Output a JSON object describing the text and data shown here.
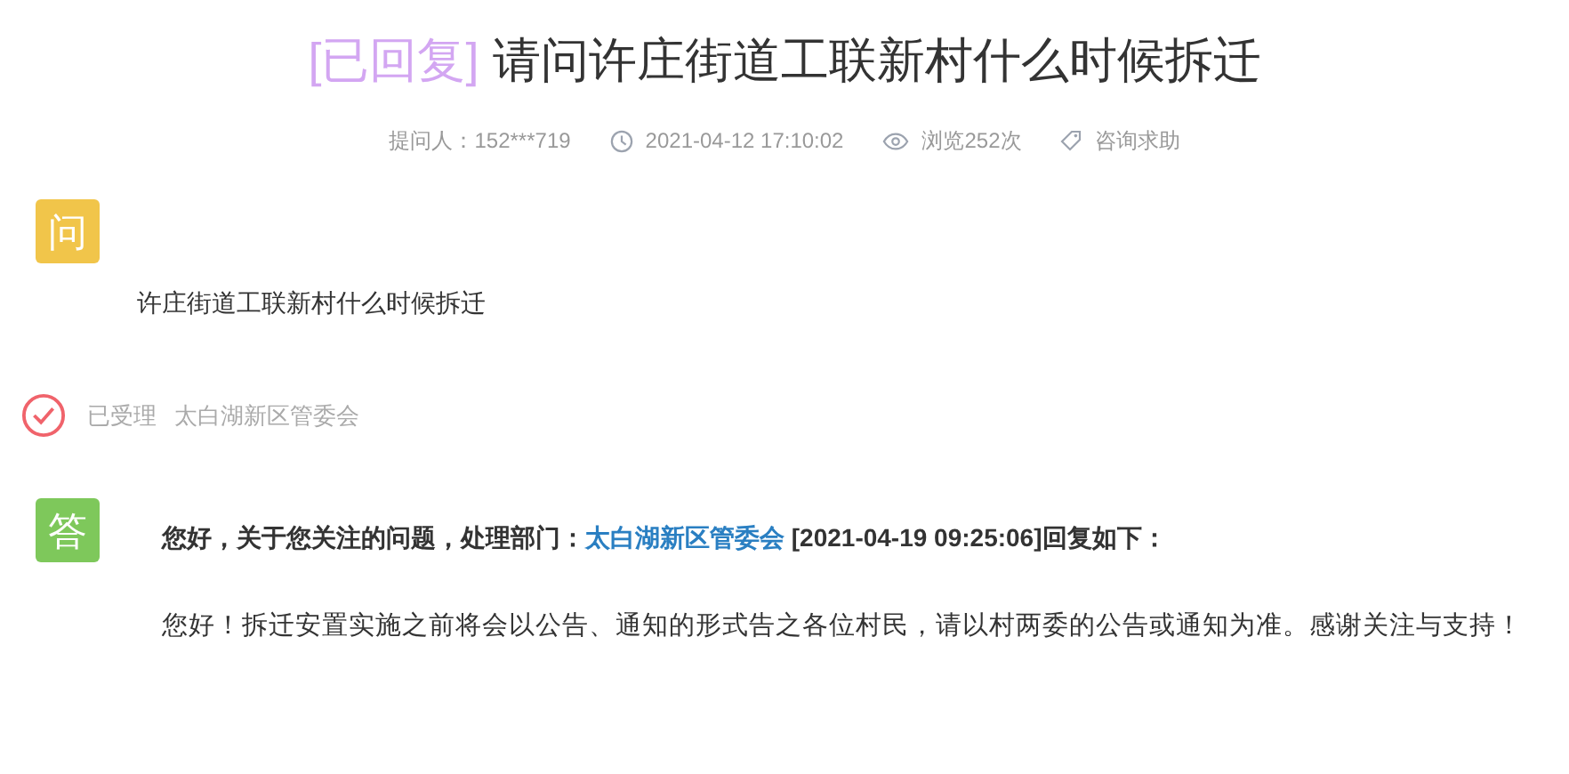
{
  "question": {
    "status": "[已回复]",
    "title": "请问许庄街道工联新村什么时候拆迁"
  },
  "meta": [
    {
      "kind": "text",
      "text": "提问人：152***719"
    },
    {
      "kind": "clock",
      "text": "2021-04-12 17:10:02"
    },
    {
      "kind": "eye",
      "text": "浏览252次"
    },
    {
      "kind": "tag",
      "text": "咨询求助"
    }
  ],
  "ask": {
    "badge": "问",
    "text": "许庄街道工联新村什么时候拆迁"
  },
  "progress": {
    "accepted": true,
    "label": "已受理",
    "department": "太白湖新区管委会"
  },
  "answer": {
    "badge": "答",
    "heading_prefix": "您好，关于您关注的问题，处理部门：",
    "department": "太白湖新区管委会",
    "heading_suffix": " [2021-04-19 09:25:06]回复如下：",
    "body": "您好！拆迁安置实施之前将会以公告、通知的形式告之各位村民，请以村两委的公告或通知为准。感谢关注与支持！"
  }
}
